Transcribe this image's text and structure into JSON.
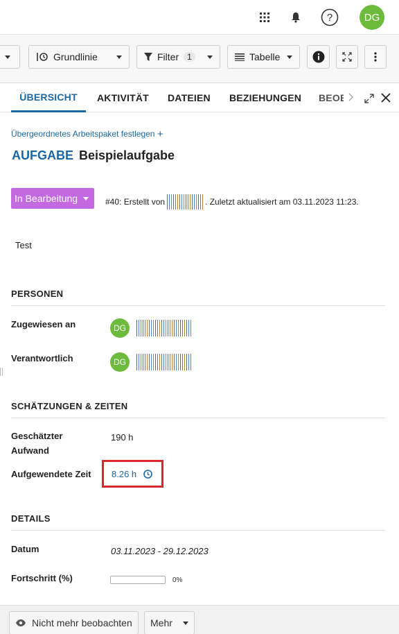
{
  "header": {
    "avatar_initials": "DG",
    "icons": [
      "grid-icon",
      "bell-icon",
      "help-icon"
    ]
  },
  "toolbar": {
    "baseline_label": "Grundlinie",
    "filter_label": "Filter",
    "filter_count": "1",
    "table_label": "Tabelle"
  },
  "tabs": {
    "overview": "ÜBERSICHT",
    "activity": "AKTIVITÄT",
    "files": "DATEIEN",
    "relations": "BEZIEHUNGEN",
    "watchers": "BEOB"
  },
  "workpackage": {
    "set_parent": "Übergeordnetes Arbeitspaket festlegen",
    "type": "AUFGABE",
    "subject": "Beispielaufgabe",
    "status": "In Bearbeitung",
    "meta_prefix": "#40: Erstellt von",
    "meta_suffix": ". Zuletzt aktualisiert am 03.11.2023 11:23.",
    "description": "Test"
  },
  "people": {
    "heading": "PERSONEN",
    "assignee_label": "Zugewiesen an",
    "assignee_initials": "DG",
    "accountable_label": "Verantwortlich",
    "accountable_initials": "DG"
  },
  "estimates": {
    "heading": "SCHÄTZUNGEN & ZEITEN",
    "estimated_label_1": "Geschätzter",
    "estimated_label_2": "Aufwand",
    "estimated_value": "190 h",
    "spent_label": "Aufgewendete Zeit",
    "spent_value": "8.26 h"
  },
  "details": {
    "heading": "DETAILS",
    "date_label": "Datum",
    "date_value": "03.11.2023 - 29.12.2023",
    "progress_label": "Fortschritt (%)",
    "progress_value": "0%",
    "progress_fraction": 0
  },
  "footer": {
    "unwatch_label": "Nicht mehr beobachten",
    "more_label": "Mehr"
  },
  "colors": {
    "accent": "#1a67a3",
    "status": "#c36ae0",
    "avatar": "#6cbb3c",
    "highlight": "#d9272e"
  }
}
